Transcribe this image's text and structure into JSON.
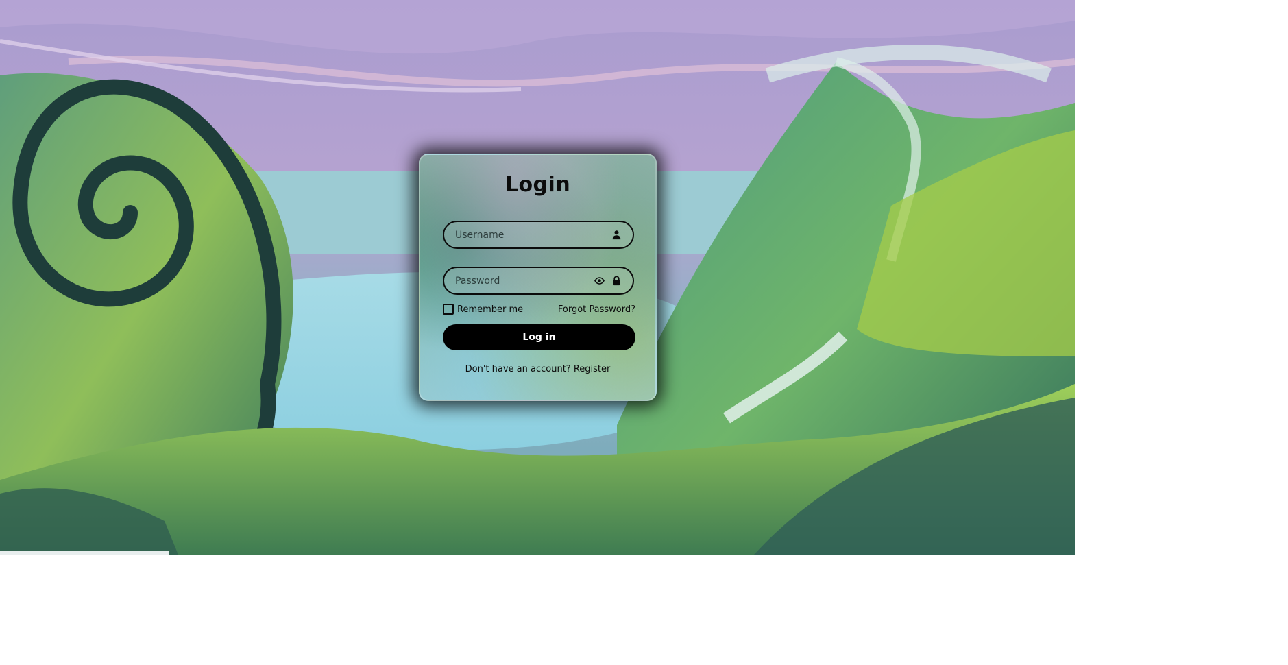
{
  "login_card": {
    "title": "Login",
    "username_placeholder": "Username",
    "password_placeholder": "Password",
    "remember_label": "Remember me",
    "remember_checked": false,
    "forgot_label": "Forgot Password?",
    "login_button": "Log in",
    "no_account_text": "Don't have an account?",
    "register_link": "Register"
  },
  "icons": {
    "username": "user-icon",
    "password_toggle": "eye-icon",
    "password": "lock-icon"
  },
  "colors": {
    "text": "#0b0b0b",
    "button_bg": "#000000",
    "button_text": "#ffffff"
  }
}
